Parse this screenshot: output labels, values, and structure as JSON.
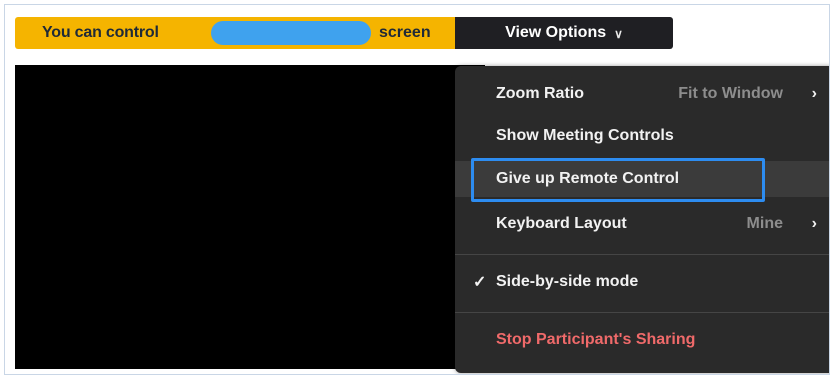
{
  "banner": {
    "prefix": "You can control",
    "suffix": "screen",
    "background_color": "#f5b400",
    "redaction_color": "#3fa2ee"
  },
  "view_options": {
    "label": "View Options",
    "chevron_icon": "chevron-down-icon"
  },
  "menu": {
    "items": [
      {
        "label": "Zoom Ratio",
        "value": "Fit to Window",
        "has_submenu": true
      },
      {
        "label": "Show Meeting Controls"
      },
      {
        "label": "Give up Remote Control",
        "highlighted": true
      },
      {
        "label": "Keyboard Layout",
        "value": "Mine",
        "has_submenu": true
      },
      {
        "label": "Side-by-side mode",
        "checked": true
      },
      {
        "label": "Stop Participant's Sharing",
        "danger": true
      }
    ],
    "highlight_color": "#2d8cf0",
    "danger_color": "#f06a6a"
  }
}
